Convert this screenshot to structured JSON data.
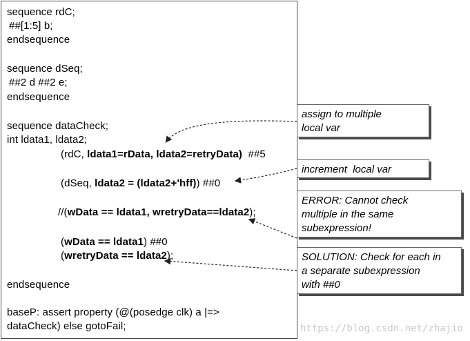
{
  "code": {
    "seq_rdc": "sequence rdC;",
    "rdc_body": "##[1:5] b;",
    "endseq1": "endsequence",
    "seq_dseq": "sequence dSeq;",
    "dseq_body": "##2 d ##2 e;",
    "endseq2": "endsequence",
    "seq_datacheck": "sequence dataCheck;",
    "int_decl": "int ldata1, ldata2;",
    "line_rdc_open": "(rdC, ",
    "line_rdc_a1": "ldata1=rData,",
    "line_rdc_sp": " ",
    "line_rdc_a2": "ldata2=retryData)",
    "line_rdc_close": "  ##5",
    "line_dseq_open": "(dSeq, ",
    "line_dseq_expr": "ldata2 = (ldata2+'hff)",
    "line_dseq_close": ") ##0",
    "line_comment_prefix": "//(",
    "line_comment_expr": "wData == ldata1, wretryData==ldata2",
    "line_comment_suffix": ");",
    "line_w1_open": "(",
    "line_w1_expr": "wData == ldata1",
    "line_w1_close": ") ##0",
    "line_w2_open": "(",
    "line_w2_expr": "wretryData == ldata2",
    "line_w2_close": ");",
    "endseq3": "endsequence",
    "assert1": "baseP: assert property (@(posedge clk) a |=>",
    "assert2": "dataCheck) else gotoFail;"
  },
  "notes": {
    "assign": "assign to multiple\nlocal var",
    "increment": "increment  local var",
    "error": "ERROR: Cannot check\nmultiple in the same\nsubexpression!",
    "solution": "SOLUTION: Check for each in\na separate subexpression\nwith ##0"
  },
  "watermark": "https://blog.csdn.net/zhajio",
  "colors": {
    "border": "#444444",
    "shadow": "#4a4a4a",
    "watermark": "#c8c8c8"
  }
}
